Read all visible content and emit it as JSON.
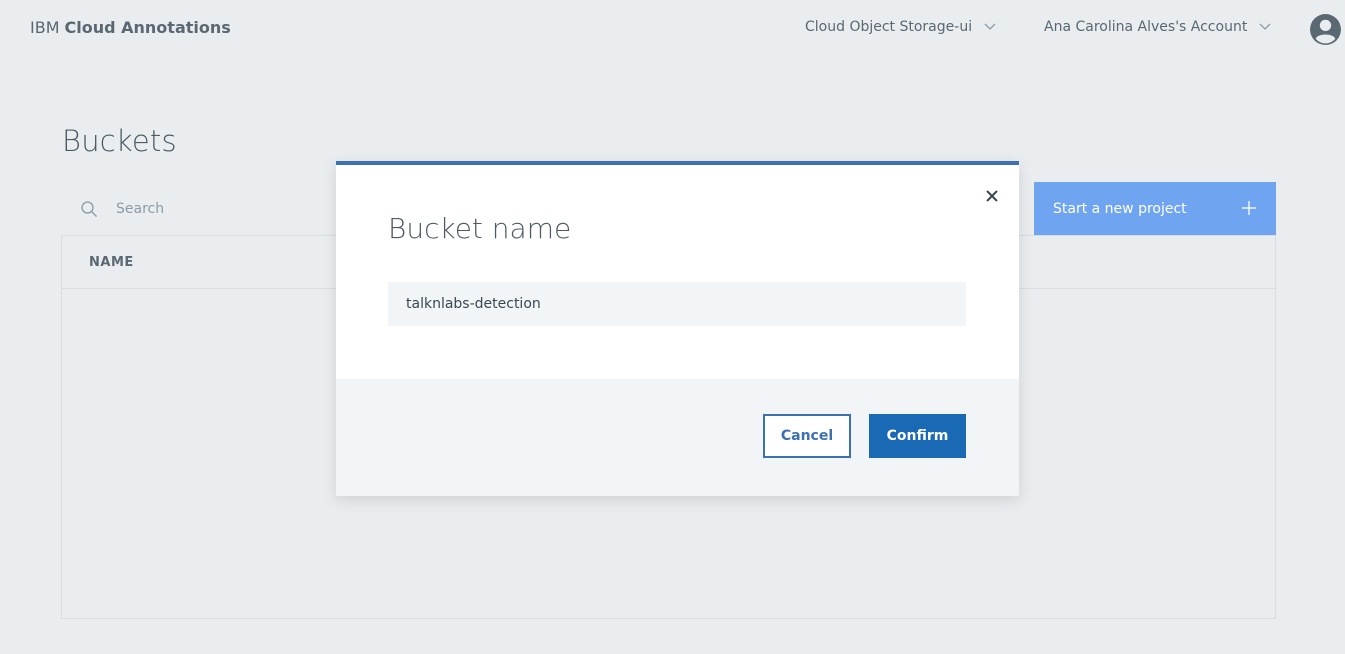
{
  "header": {
    "brand_prefix": "IBM",
    "brand_product": "Cloud Annotations",
    "storage_dropdown": "Cloud Object Storage-ui",
    "account_dropdown": "Ana Carolina Alves's Account",
    "avatar_icon": "user-avatar-icon"
  },
  "page": {
    "title": "Buckets",
    "search_placeholder": "Search",
    "new_project_label": "Start a new project",
    "table": {
      "columns": [
        "NAME"
      ],
      "rows": []
    }
  },
  "modal": {
    "title": "Bucket name",
    "input_value": "talknlabs-detection",
    "cancel_label": "Cancel",
    "confirm_label": "Confirm"
  },
  "colors": {
    "accent": "#3d70b2",
    "primary_button": "#1a69b5",
    "new_project_button": "#6fa5f0",
    "background": "#eaedef"
  }
}
